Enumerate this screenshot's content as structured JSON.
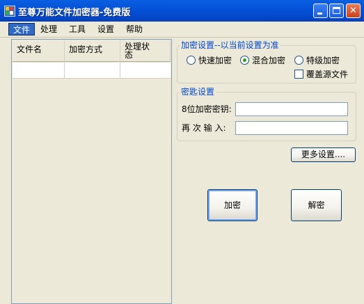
{
  "window": {
    "title": "至尊万能文件加密器-免费版"
  },
  "menu": {
    "items": [
      {
        "label": "文件"
      },
      {
        "label": "处理"
      },
      {
        "label": "工具"
      },
      {
        "label": "设置"
      },
      {
        "label": "帮助"
      }
    ]
  },
  "file_list": {
    "columns": [
      "文件名",
      "加密方式",
      "处理状\n态"
    ]
  },
  "encrypt_settings": {
    "title": "加密设置--以当前设置为准",
    "options": [
      "快速加密",
      "混合加密",
      "特级加密"
    ],
    "selected": "混合加密",
    "overwrite_label": "覆盖源文件",
    "overwrite_checked": false
  },
  "key_settings": {
    "title": "密匙设置",
    "key_label": "8位加密密钥:",
    "key_value": "",
    "confirm_label": "再 次 输 入:",
    "confirm_value": ""
  },
  "buttons": {
    "more_settings": "更多设置....",
    "encrypt": "加密",
    "decrypt": "解密"
  },
  "colors": {
    "titlebar": "#0552d8",
    "group_title": "#0046d5",
    "window_bg": "#ece9d8"
  }
}
